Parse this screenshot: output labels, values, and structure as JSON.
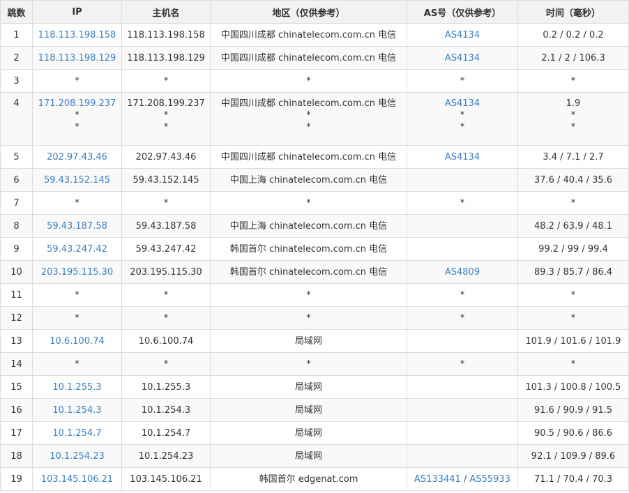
{
  "headers": [
    "跳数",
    "IP",
    "主机名",
    "地区（仅供参考）",
    "AS号（仅供参考）",
    "时间（毫秒）"
  ],
  "rows": [
    {
      "hop": "1",
      "ip": [
        "118.113.198.158"
      ],
      "host": [
        "118.113.198.158"
      ],
      "region": [
        "中国四川成都 chinatelecom.com.cn 电信"
      ],
      "as": [
        [
          "AS4134"
        ]
      ],
      "time": [
        "0.2 / 0.2 / 0.2"
      ]
    },
    {
      "hop": "2",
      "ip": [
        "118.113.198.129"
      ],
      "host": [
        "118.113.198.129"
      ],
      "region": [
        "中国四川成都 chinatelecom.com.cn 电信"
      ],
      "as": [
        [
          "AS4134"
        ]
      ],
      "time": [
        "2.1 / 2 / 106.3"
      ]
    },
    {
      "hop": "3",
      "ip": [
        "*"
      ],
      "host": [
        "*"
      ],
      "region": [
        "*"
      ],
      "as": [
        [
          "*"
        ]
      ],
      "time": [
        "*"
      ]
    },
    {
      "hop": "4",
      "ip": [
        "171.208.199.237",
        "*",
        "*"
      ],
      "host": [
        "171.208.199.237",
        "*",
        "*"
      ],
      "region": [
        "中国四川成都 chinatelecom.com.cn 电信",
        "*",
        "*"
      ],
      "as": [
        [
          "AS4134"
        ],
        [
          "*"
        ],
        [
          "*"
        ]
      ],
      "time": [
        "1.9",
        "*",
        "*"
      ]
    },
    {
      "hop": "5",
      "ip": [
        "202.97.43.46"
      ],
      "host": [
        "202.97.43.46"
      ],
      "region": [
        "中国四川成都 chinatelecom.com.cn 电信"
      ],
      "as": [
        [
          "AS4134"
        ]
      ],
      "time": [
        "3.4 / 7.1 / 2.7"
      ]
    },
    {
      "hop": "6",
      "ip": [
        "59.43.152.145"
      ],
      "host": [
        "59.43.152.145"
      ],
      "region": [
        "中国上海 chinatelecom.com.cn 电信"
      ],
      "as": [
        []
      ],
      "time": [
        "37.6 / 40.4 / 35.6"
      ]
    },
    {
      "hop": "7",
      "ip": [
        "*"
      ],
      "host": [
        "*"
      ],
      "region": [
        "*"
      ],
      "as": [
        [
          "*"
        ]
      ],
      "time": [
        "*"
      ]
    },
    {
      "hop": "8",
      "ip": [
        "59.43.187.58"
      ],
      "host": [
        "59.43.187.58"
      ],
      "region": [
        "中国上海 chinatelecom.com.cn 电信"
      ],
      "as": [
        []
      ],
      "time": [
        "48.2 / 63.9 / 48.1"
      ]
    },
    {
      "hop": "9",
      "ip": [
        "59.43.247.42"
      ],
      "host": [
        "59.43.247.42"
      ],
      "region": [
        "韩国首尔 chinatelecom.com.cn 电信"
      ],
      "as": [
        []
      ],
      "time": [
        "99.2 / 99 / 99.4"
      ]
    },
    {
      "hop": "10",
      "ip": [
        "203.195.115.30"
      ],
      "host": [
        "203.195.115.30"
      ],
      "region": [
        "韩国首尔 chinatelecom.com.cn 电信"
      ],
      "as": [
        [
          "AS4809"
        ]
      ],
      "time": [
        "89.3 / 85.7 / 86.4"
      ]
    },
    {
      "hop": "11",
      "ip": [
        "*"
      ],
      "host": [
        "*"
      ],
      "region": [
        "*"
      ],
      "as": [
        [
          "*"
        ]
      ],
      "time": [
        "*"
      ]
    },
    {
      "hop": "12",
      "ip": [
        "*"
      ],
      "host": [
        "*"
      ],
      "region": [
        "*"
      ],
      "as": [
        [
          "*"
        ]
      ],
      "time": [
        "*"
      ]
    },
    {
      "hop": "13",
      "ip": [
        "10.6.100.74"
      ],
      "host": [
        "10.6.100.74"
      ],
      "region": [
        "局域网"
      ],
      "as": [
        []
      ],
      "time": [
        "101.9 / 101.6 / 101.9"
      ]
    },
    {
      "hop": "14",
      "ip": [
        "*"
      ],
      "host": [
        "*"
      ],
      "region": [
        "*"
      ],
      "as": [
        [
          "*"
        ]
      ],
      "time": [
        "*"
      ]
    },
    {
      "hop": "15",
      "ip": [
        "10.1.255.3"
      ],
      "host": [
        "10.1.255.3"
      ],
      "region": [
        "局域网"
      ],
      "as": [
        []
      ],
      "time": [
        "101.3 / 100.8 / 100.5"
      ]
    },
    {
      "hop": "16",
      "ip": [
        "10.1.254.3"
      ],
      "host": [
        "10.1.254.3"
      ],
      "region": [
        "局域网"
      ],
      "as": [
        []
      ],
      "time": [
        "91.6 / 90.9 / 91.5"
      ]
    },
    {
      "hop": "17",
      "ip": [
        "10.1.254.7"
      ],
      "host": [
        "10.1.254.7"
      ],
      "region": [
        "局域网"
      ],
      "as": [
        []
      ],
      "time": [
        "90.5 / 90.6 / 86.6"
      ]
    },
    {
      "hop": "18",
      "ip": [
        "10.1.254.23"
      ],
      "host": [
        "10.1.254.23"
      ],
      "region": [
        "局域网"
      ],
      "as": [
        []
      ],
      "time": [
        "92.1 / 109.9 / 89.6"
      ]
    },
    {
      "hop": "19",
      "ip": [
        "103.145.106.21"
      ],
      "host": [
        "103.145.106.21"
      ],
      "region": [
        "韩国首尔 edgenat.com"
      ],
      "as": [
        [
          "AS133441",
          "AS55933"
        ]
      ],
      "time": [
        "71.1 / 70.4 / 70.3"
      ]
    }
  ],
  "colors": {
    "link": "#3a7fc1",
    "header_bg": "#f2f2f2",
    "border": "#dcdcdc",
    "stripe": "#f9f9f9"
  }
}
